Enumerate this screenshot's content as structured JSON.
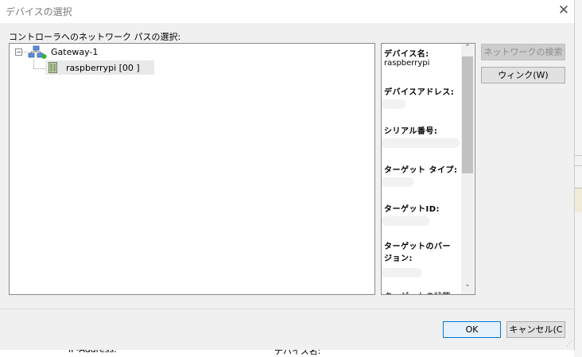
{
  "dialog": {
    "title": "デバイスの選択",
    "close_symbol": "✕",
    "path_label": "コントローラへのネットワーク パスの選択:"
  },
  "tree": {
    "gateway": {
      "label": "Gateway-1",
      "expander": "⊟",
      "icon": "network-gateway-icon"
    },
    "device": {
      "label": "raspberrypi [00   ]",
      "icon": "device-icon",
      "selected": true
    }
  },
  "properties": {
    "device_name_label": "デバイス名:",
    "device_name_value": "raspberrypi",
    "device_address_label": "デバイスアドレス:",
    "serial_label": "シリアル番号:",
    "target_type_label": "ターゲット タイプ:",
    "target_id_label": "ターゲットID:",
    "target_version_label": "ターゲットのバージョン:",
    "scroll_up": "⌃",
    "scroll_down": "⌄"
  },
  "buttons": {
    "network_search": "ネットワークの検索",
    "wink": "ウィンク(W)",
    "ok": "OK",
    "cancel": "キャンセル(C"
  },
  "background": {
    "left_text": "IP-Address:",
    "right_text": "デバイス名:"
  }
}
